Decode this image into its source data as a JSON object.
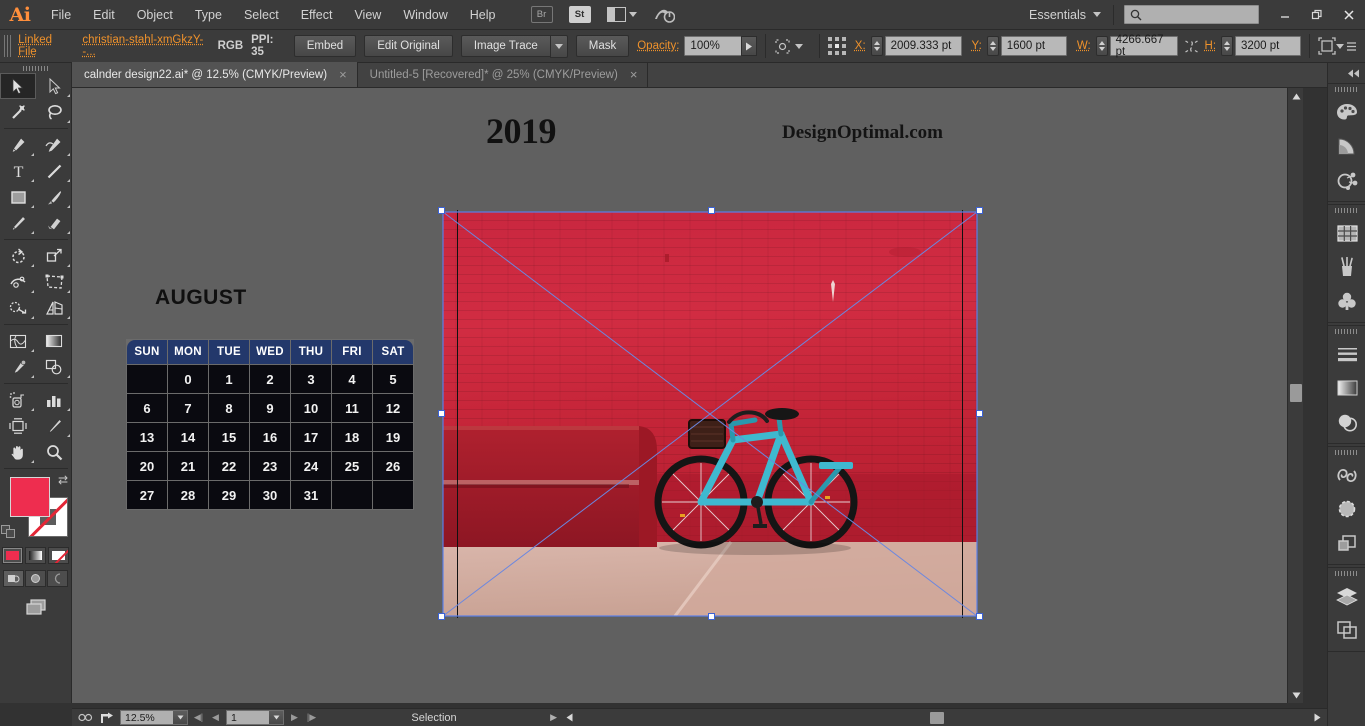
{
  "app": {
    "logo": "Ai",
    "menus": [
      "File",
      "Edit",
      "Object",
      "Type",
      "Select",
      "Effect",
      "View",
      "Window",
      "Help"
    ],
    "bridge_label": "Br",
    "stock_label": "St",
    "workspace": "Essentials",
    "search_placeholder": "",
    "search_value": ""
  },
  "control_bar": {
    "link_status": "Linked File",
    "file_name": "christian-stahl-xmGkzY--...",
    "color_mode": "RGB",
    "ppi": "PPI: 35",
    "embed_label": "Embed",
    "edit_original_label": "Edit Original",
    "image_trace_label": "Image Trace",
    "mask_label": "Mask",
    "opacity_label": "Opacity:",
    "opacity_value": "100%",
    "x_label": "X:",
    "x_value": "2009.333 pt",
    "y_label": "Y:",
    "y_value": "1600 pt",
    "w_label": "W:",
    "w_value": "4266.667 pt",
    "h_label": "H:",
    "h_value": "3200 pt"
  },
  "tabs": [
    {
      "label": "calnder design22.ai* @ 12.5% (CMYK/Preview)",
      "active": true,
      "close": "×"
    },
    {
      "label": "Untitled-5 [Recovered]* @ 25% (CMYK/Preview)",
      "active": false,
      "close": "×"
    }
  ],
  "toolbar": {
    "tools": [
      "selection-tool",
      "direct-selection-tool",
      "magic-wand-tool",
      "lasso-tool",
      "pen-tool",
      "curvature-tool",
      "type-tool",
      "line-segment-tool",
      "rectangle-tool",
      "paintbrush-tool",
      "pencil-tool",
      "eraser-tool",
      "rotate-tool",
      "scale-tool",
      "width-tool",
      "free-transform-tool",
      "shape-builder-tool",
      "perspective-grid-tool",
      "mesh-tool",
      "gradient-tool",
      "eyedropper-tool",
      "blend-tool",
      "symbol-sprayer-tool",
      "column-graph-tool",
      "artboard-tool",
      "slice-tool",
      "hand-tool",
      "zoom-tool"
    ],
    "fill_color": "#ee2d4f",
    "stroke_color": "#ffffff",
    "selected_tool": "selection-tool"
  },
  "artwork": {
    "year": "2019",
    "watermark": "DesignOptimal.com",
    "month": "AUGUST",
    "day_headers": [
      "SUN",
      "MON",
      "TUE",
      "WED",
      "THU",
      "FRI",
      "SAT"
    ],
    "weeks": [
      [
        "",
        "0",
        "1",
        "2",
        "3",
        "4",
        "5"
      ],
      [
        "6",
        "7",
        "8",
        "9",
        "10",
        "11",
        "12"
      ],
      [
        "13",
        "14",
        "15",
        "16",
        "17",
        "18",
        "19"
      ],
      [
        "20",
        "21",
        "22",
        "23",
        "24",
        "25",
        "26"
      ],
      [
        "27",
        "28",
        "29",
        "30",
        "31",
        "",
        ""
      ]
    ],
    "header_color": "#23386b",
    "cell_color": "#0a0a10",
    "photo_description": "teal bicycle leaning against red brick wall with red bench"
  },
  "status_bar": {
    "zoom_level": "12.5%",
    "page_number": "1",
    "tool_status": "Selection"
  },
  "right_dock": {
    "collapse_label": "«",
    "groups": [
      [
        "color-panel-icon",
        "color-guide-icon",
        "recolor-artwork-icon"
      ],
      [
        "swatches-panel-icon",
        "brushes-panel-icon",
        "symbols-panel-icon"
      ],
      [
        "stroke-panel-icon",
        "gradient-panel-icon",
        "transparency-panel-icon"
      ],
      [
        "libraries-panel-icon",
        "appearance-panel-icon",
        "graphic-styles-icon"
      ],
      [
        "layers-panel-icon",
        "artboards-panel-icon"
      ]
    ]
  }
}
